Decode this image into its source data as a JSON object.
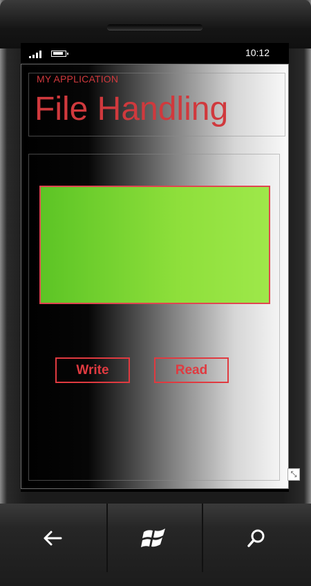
{
  "status_bar": {
    "time": "10:12",
    "icons": [
      "signal-icon",
      "battery-icon"
    ]
  },
  "app": {
    "application_title": "MY APPLICATION",
    "page_title": "File Handling",
    "text_box_value": "",
    "buttons": {
      "write_label": "Write",
      "read_label": "Read"
    }
  },
  "hardware_buttons": [
    "back-icon",
    "windows-start-icon",
    "search-icon"
  ],
  "colors": {
    "accent": "#e03a40",
    "text_box_fill": "#7cd834"
  }
}
